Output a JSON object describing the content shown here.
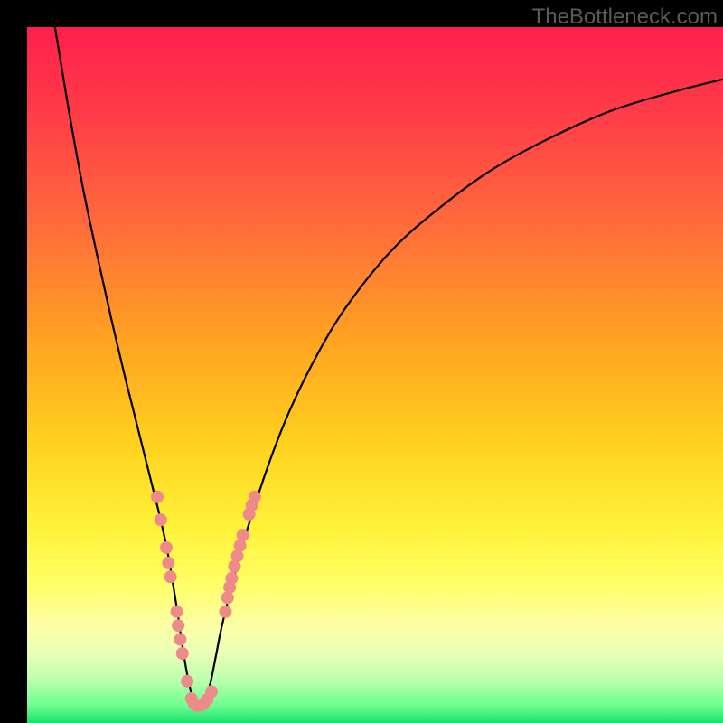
{
  "watermark": "TheBottleneck.com",
  "chart_data": {
    "type": "line",
    "title": "",
    "xlabel": "",
    "ylabel": "",
    "xlim": [
      0,
      100
    ],
    "ylim": [
      0,
      100
    ],
    "grid": false,
    "legend": false,
    "gradient_stops": [
      {
        "offset": 0.0,
        "color": "#ff1f4b"
      },
      {
        "offset": 0.12,
        "color": "#ff3b48"
      },
      {
        "offset": 0.28,
        "color": "#ff6a3c"
      },
      {
        "offset": 0.45,
        "color": "#ffa321"
      },
      {
        "offset": 0.6,
        "color": "#ffd21f"
      },
      {
        "offset": 0.72,
        "color": "#fff23a"
      },
      {
        "offset": 0.8,
        "color": "#ffff66"
      },
      {
        "offset": 0.86,
        "color": "#fdffa6"
      },
      {
        "offset": 0.9,
        "color": "#e9ffb5"
      },
      {
        "offset": 0.94,
        "color": "#b8ffad"
      },
      {
        "offset": 0.975,
        "color": "#6dff8f"
      },
      {
        "offset": 1.0,
        "color": "#18e06a"
      }
    ],
    "series": [
      {
        "name": "bottleneck-curve",
        "color": "#000000",
        "width": 2.2,
        "x": [
          4,
          6,
          8,
          10,
          12,
          14,
          15,
          16,
          17,
          18,
          19,
          20,
          20.8,
          21.6,
          22.4,
          23.2,
          24,
          24.8,
          25.6,
          26.4,
          27.2,
          28,
          30,
          32,
          35,
          38,
          42,
          46,
          52,
          58,
          66,
          74,
          84,
          94,
          100
        ],
        "y": [
          100,
          88,
          77,
          67.5,
          58.5,
          50,
          46,
          42,
          38,
          34,
          30,
          25.5,
          21,
          16,
          10.5,
          6,
          3,
          2,
          3,
          6,
          10,
          14,
          22,
          29,
          38,
          45.5,
          53.5,
          60,
          67.5,
          73,
          79,
          83.5,
          88,
          91,
          92.5
        ]
      }
    ],
    "scatter_points": {
      "name": "highlighted-points",
      "color": "#ef8a8a",
      "radius": 7,
      "points": [
        {
          "x": 18.7,
          "y": 32.5
        },
        {
          "x": 19.2,
          "y": 29.2
        },
        {
          "x": 20.0,
          "y": 25.2
        },
        {
          "x": 20.3,
          "y": 23.0
        },
        {
          "x": 20.6,
          "y": 21.0
        },
        {
          "x": 21.5,
          "y": 16.0
        },
        {
          "x": 21.7,
          "y": 14.0
        },
        {
          "x": 22.0,
          "y": 12.0
        },
        {
          "x": 22.3,
          "y": 10.0
        },
        {
          "x": 23.0,
          "y": 6.0
        },
        {
          "x": 23.6,
          "y": 3.5
        },
        {
          "x": 24.0,
          "y": 2.8
        },
        {
          "x": 24.4,
          "y": 2.5
        },
        {
          "x": 24.9,
          "y": 2.5
        },
        {
          "x": 25.4,
          "y": 2.8
        },
        {
          "x": 25.9,
          "y": 3.4
        },
        {
          "x": 26.5,
          "y": 4.5
        },
        {
          "x": 28.5,
          "y": 16.0
        },
        {
          "x": 28.8,
          "y": 18.0
        },
        {
          "x": 29.1,
          "y": 19.5
        },
        {
          "x": 29.4,
          "y": 20.8
        },
        {
          "x": 29.8,
          "y": 22.5
        },
        {
          "x": 30.2,
          "y": 24.0
        },
        {
          "x": 30.6,
          "y": 25.5
        },
        {
          "x": 31.0,
          "y": 27.0
        },
        {
          "x": 31.9,
          "y": 30.0
        },
        {
          "x": 32.3,
          "y": 31.3
        },
        {
          "x": 32.7,
          "y": 32.5
        }
      ]
    }
  }
}
